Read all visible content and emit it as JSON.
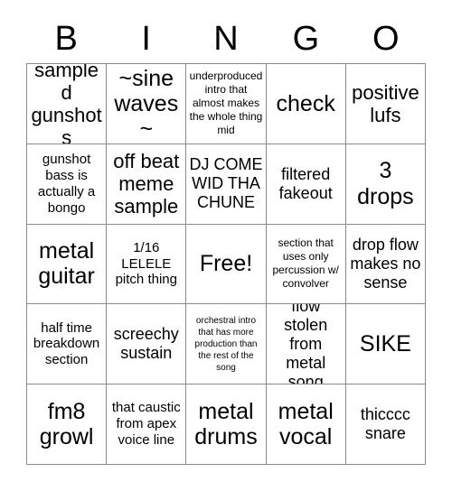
{
  "card": {
    "title": "BINGO",
    "header_letters": [
      "B",
      "I",
      "N",
      "G",
      "O"
    ],
    "free_space_label": "Free!",
    "free_space_index": 12,
    "rows": 5,
    "columns": 5,
    "colors": {
      "background": "#ffffff",
      "text": "#000000",
      "border": "#8a8a8a"
    },
    "cells": [
      {
        "text": "sampled gunshots",
        "size": "lg"
      },
      {
        "text": "~sine waves~",
        "size": "xl"
      },
      {
        "text": "underproduced intro that almost makes the whole thing mid",
        "size": "xs"
      },
      {
        "text": "check",
        "size": "xl"
      },
      {
        "text": "positive lufs",
        "size": "lg"
      },
      {
        "text": "gunshot bass is actually a bongo",
        "size": "sm"
      },
      {
        "text": "off beat meme sample",
        "size": "lg"
      },
      {
        "text": "DJ COME WID THA CHUNE",
        "size": "md"
      },
      {
        "text": "filtered fakeout",
        "size": "md"
      },
      {
        "text": "3 drops",
        "size": "xl"
      },
      {
        "text": "metal guitar",
        "size": "xl"
      },
      {
        "text": "1/16 LELELE pitch thing",
        "size": "sm"
      },
      {
        "text": "Free!",
        "size": "xl"
      },
      {
        "text": "section that uses only percussion w/ convolver",
        "size": "xs"
      },
      {
        "text": "drop flow makes no sense",
        "size": "md"
      },
      {
        "text": "half time breakdown section",
        "size": "sm"
      },
      {
        "text": "screechy sustain",
        "size": "md"
      },
      {
        "text": "orchestral intro that has more production than the rest of the song",
        "size": "xxs"
      },
      {
        "text": "flow stolen from metal song",
        "size": "md"
      },
      {
        "text": "SIKE",
        "size": "xl"
      },
      {
        "text": "fm8 growl",
        "size": "xl"
      },
      {
        "text": "that caustic from apex voice line",
        "size": "sm"
      },
      {
        "text": "metal drums",
        "size": "xl"
      },
      {
        "text": "metal vocal",
        "size": "xl"
      },
      {
        "text": "thicccc snare",
        "size": "md"
      }
    ]
  }
}
